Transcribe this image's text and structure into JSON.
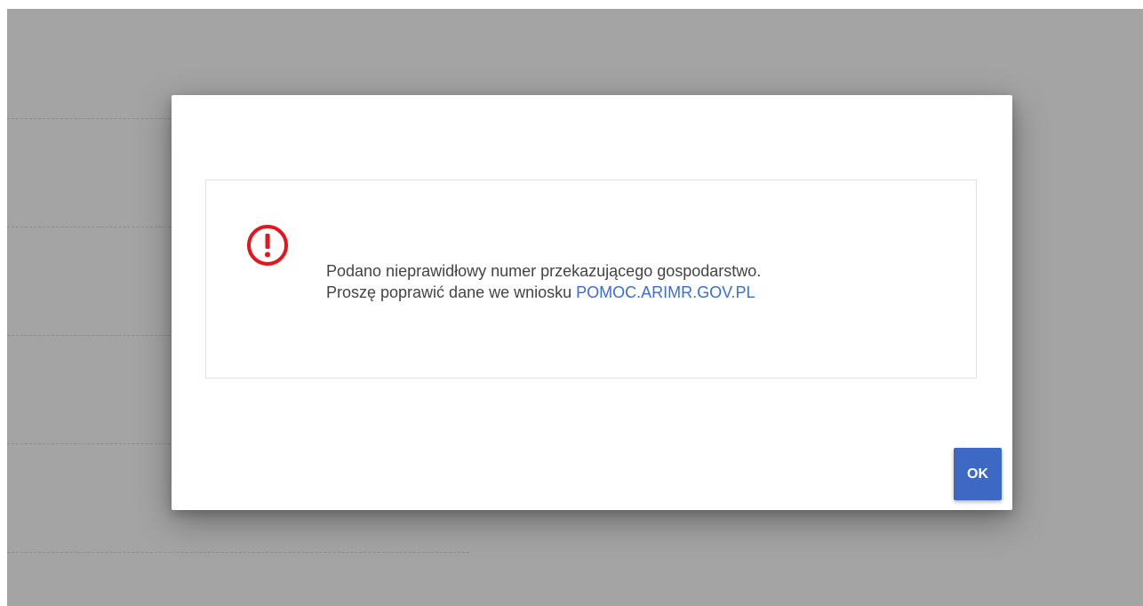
{
  "dialog": {
    "message_line1": "Podano nieprawidłowy numer przekazującego gospodarstwo.",
    "message_line2_prefix": "Proszę poprawić dane we wniosku ",
    "message_link": "POMOC.ARIMR.GOV.PL",
    "icon": "exclamation-circle-icon",
    "ok_label": "OK"
  },
  "colors": {
    "backdrop": "#a4a4a4",
    "error_icon": "#e8141a",
    "link": "#3a6fcf",
    "button": "#3d68c4"
  }
}
